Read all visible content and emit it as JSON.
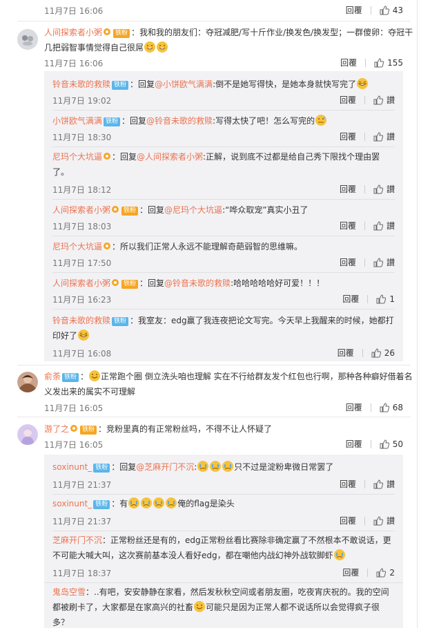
{
  "labels": {
    "reply": "回覆",
    "delete": "讃"
  },
  "top": {
    "time": "11月7日 16:06",
    "likes": "43"
  },
  "comments": [
    {
      "user": "人间探索者小粥",
      "badge": "铁粉",
      "text": "：我和我的朋友们：夺冠减肥/写十斤作业/换发色/换发型；一群傻卵：夺冠干几把弱智事情觉得自己很屌",
      "time": "11月7日 16:06",
      "likes": "155",
      "replies": [
        {
          "user": "铃音未歌的救赎",
          "badge": "铁粉",
          "pre": "：回复",
          "at": "@小饼欧气满满",
          "text": ":倒不是她写得快，是她本身就快写完了",
          "time": "11月7日 19:02"
        },
        {
          "user": "小饼欧气满满",
          "badge": "铁粉",
          "pre": "：回复",
          "at": "@铃音未歌的救赎",
          "text": ":写得太快了吧！怎么写完的",
          "time": "11月7日 18:30"
        },
        {
          "user": "尼玛个大坑逼",
          "badge": "",
          "pre": "：回复",
          "at": "@人间探索者小粥",
          "text": ":正解，说到底不过都是给自己秀下限找个理由罢了。",
          "time": "11月7日 18:12"
        },
        {
          "user": "人间探索者小粥",
          "badge": "铁粉",
          "pre": "：回复",
          "at": "@尼玛个大坑逼",
          "text": ":“哗众取宠”真实小丑了",
          "time": "11月7日 18:03"
        },
        {
          "user": "尼玛个大坑逼",
          "badge": "",
          "pre": "",
          "at": "",
          "text": "：所以我们正常人永远不能理解奇葩弱智的思维嘛。",
          "time": "11月7日 17:50"
        },
        {
          "user": "人间探索者小粥",
          "badge": "铁粉",
          "pre": "：回复",
          "at": "@铃音未歌的救赎",
          "text": ":哈哈哈哈哈好可爱！！！",
          "time": "11月7日 16:23",
          "likes": "1"
        },
        {
          "user": "铃音未歌的救赎",
          "badge": "铁粉",
          "pre": "",
          "at": "",
          "text": "：我室友：edg赢了我连夜把论文写完。今天早上我醒来的时候，她都打印好了",
          "time": "11月7日 16:08",
          "likes": "26"
        }
      ]
    },
    {
      "user": "俞荼",
      "badge": "铁粉",
      "text": "正常跑个圈 倒立洗头咱也理解 实在不行给群友发个红包也行啊，那种各种癖好借着名义发出来的属实不可理解",
      "time": "11月7日 16:05",
      "likes": "68"
    },
    {
      "user": "游了之",
      "badge": "铁粉",
      "text": "：竞粉里真的有正常粉丝吗，不得不让人怀疑了",
      "time": "11月7日 16:05",
      "likes": "50",
      "replies": [
        {
          "user": "soxinunt_",
          "badge": "铁粉",
          "pre": "：回复",
          "at": "@芝麻开门不沉",
          "text": "只不过是淀粉卑微日常罢了",
          "time": "11月7日 21:37"
        },
        {
          "user": "soxinunt_",
          "badge": "铁粉",
          "pre": "：有",
          "at": "",
          "text": "俺的flag是染头",
          "time": "11月7日 21:37"
        },
        {
          "user": "芝麻开门不沉",
          "badge": "",
          "pre": "",
          "at": "",
          "text": "：正常粉丝还是有的，edg正常粉丝看比赛除非确定赢了不然根本不敢说话，更不可能大喊大叫，这次赛前基本没人看好edg，都在嘲他内战幻神外战软脚虾",
          "time": "11月7日 18:37",
          "likes": "2"
        }
      ]
    },
    {
      "user": "鬼岛空雪",
      "badge": "",
      "text": "：..有吧，安安静静在家看，然后发秋秋空间或者朋友圈，吃夜宵庆祝的。我的空间都被刷卡了，大家都是在家高兴的社畜",
      "text2": "可能只是因为正常人都不说话所以会觉得疯子很多？"
    }
  ]
}
